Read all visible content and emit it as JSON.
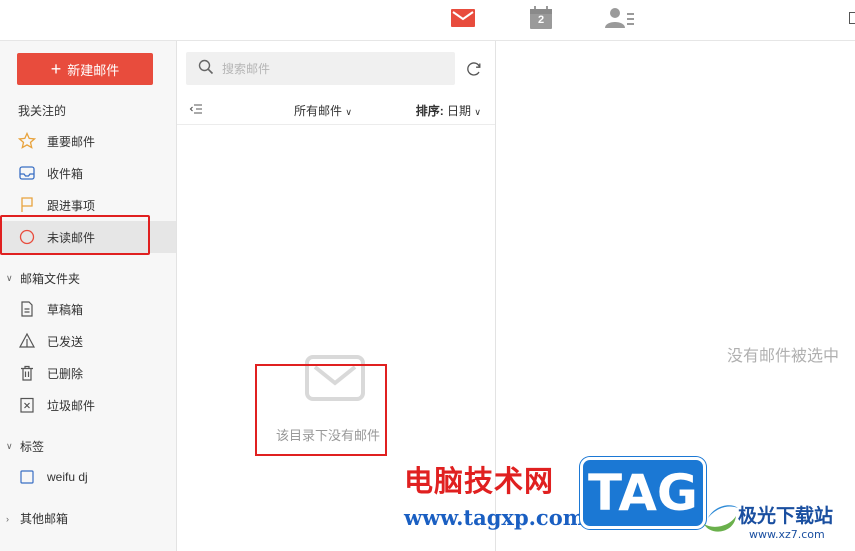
{
  "topbar": {
    "icons": [
      "mail-icon",
      "calendar-icon",
      "contacts-icon"
    ],
    "calendar_day": "2",
    "accent": "#e84c3d"
  },
  "sidebar": {
    "compose_label": "新建邮件",
    "favorites_title": "我关注的",
    "favorites": [
      {
        "label": "重要邮件",
        "icon": "star-icon"
      },
      {
        "label": "收件箱",
        "icon": "inbox-icon"
      },
      {
        "label": "跟进事项",
        "icon": "flag-icon"
      },
      {
        "label": "未读邮件",
        "icon": "unread-circle-icon"
      }
    ],
    "folders_title": "邮箱文件夹",
    "folders": [
      {
        "label": "草稿箱",
        "icon": "draft-icon"
      },
      {
        "label": "已发送",
        "icon": "sent-icon"
      },
      {
        "label": "已删除",
        "icon": "trash-icon"
      },
      {
        "label": "垃圾邮件",
        "icon": "spam-icon"
      }
    ],
    "tags_title": "标签",
    "tags": [
      {
        "label": "weifu dj",
        "icon": "tag-checkbox-icon"
      }
    ],
    "other_title": "其他邮箱"
  },
  "list": {
    "search_placeholder": "搜索邮件",
    "filter_label": "所有邮件",
    "sort_prefix": "排序:",
    "sort_value": "日期",
    "empty_text": "该目录下没有邮件"
  },
  "reading": {
    "empty_text": "没有邮件被选中"
  },
  "watermark": {
    "cn_text": "电脑技术网",
    "url": "www.tagxp.com",
    "tag": "TAG",
    "site_name": "极光下载站",
    "site_url": "www.xz7.com"
  }
}
